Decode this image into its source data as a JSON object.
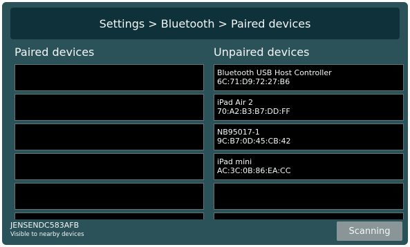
{
  "header": {
    "breadcrumb": "Settings > Bluetooth > Paired devices"
  },
  "paired": {
    "title": "Paired devices",
    "rows": [
      {
        "name": "",
        "address": ""
      },
      {
        "name": "",
        "address": ""
      },
      {
        "name": "",
        "address": ""
      },
      {
        "name": "",
        "address": ""
      },
      {
        "name": "",
        "address": ""
      },
      {
        "name": "",
        "address": ""
      }
    ]
  },
  "unpaired": {
    "title": "Unpaired devices",
    "rows": [
      {
        "name": "Bluetooth USB Host Controller",
        "address": "6C:71:D9:72:27:B6"
      },
      {
        "name": "iPad Air 2",
        "address": "70:A2:B3:B7:DD:FF"
      },
      {
        "name": "NB95017-1",
        "address": "9C:B7:0D:45:CB:42"
      },
      {
        "name": "iPad mini",
        "address": "AC:3C:0B:86:EA:CC"
      },
      {
        "name": "",
        "address": ""
      },
      {
        "name": "",
        "address": ""
      }
    ]
  },
  "footer": {
    "device_id": "JENSENDC583AFB",
    "visibility": "Visible to nearby devices",
    "scan_label": "Scanning"
  },
  "colors": {
    "background": "#2b5159",
    "header": "#0f313a",
    "row": "#000000",
    "button": "#8a9598"
  }
}
